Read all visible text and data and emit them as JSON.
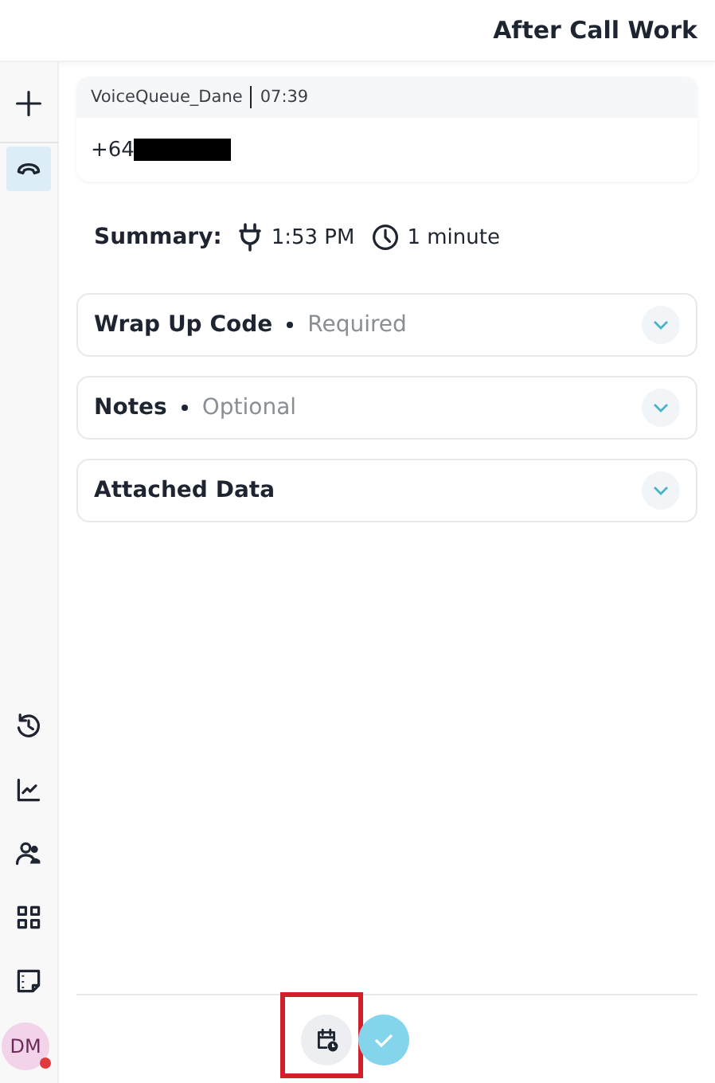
{
  "header": {
    "title": "After Call Work"
  },
  "sidebar": {
    "items": [
      {
        "kind": "plus",
        "selected": false
      },
      {
        "kind": "phone",
        "selected": true
      },
      {
        "kind": "history",
        "selected": false
      },
      {
        "kind": "chart",
        "selected": false
      },
      {
        "kind": "people",
        "selected": false
      },
      {
        "kind": "grid",
        "selected": false
      },
      {
        "kind": "note",
        "selected": false
      }
    ],
    "avatar": {
      "initials": "DM",
      "busy": true
    }
  },
  "call": {
    "queue": "VoiceQueue_Dane",
    "time": "07:39",
    "number": "+64",
    "number_redacted": true
  },
  "summary": {
    "label": "Summary:",
    "start": "1:53 PM",
    "duration": "1 minute"
  },
  "sections": [
    {
      "title": "Wrap Up Code",
      "hint": "Required",
      "expanded": false
    },
    {
      "title": "Notes",
      "hint": "Optional",
      "expanded": false
    },
    {
      "title": "Attached Data",
      "expanded": false
    }
  ],
  "footer": {
    "buttons": [
      {
        "kind": "schedule",
        "highlighted": true
      },
      {
        "kind": "complete",
        "highlighted": false
      }
    ]
  }
}
